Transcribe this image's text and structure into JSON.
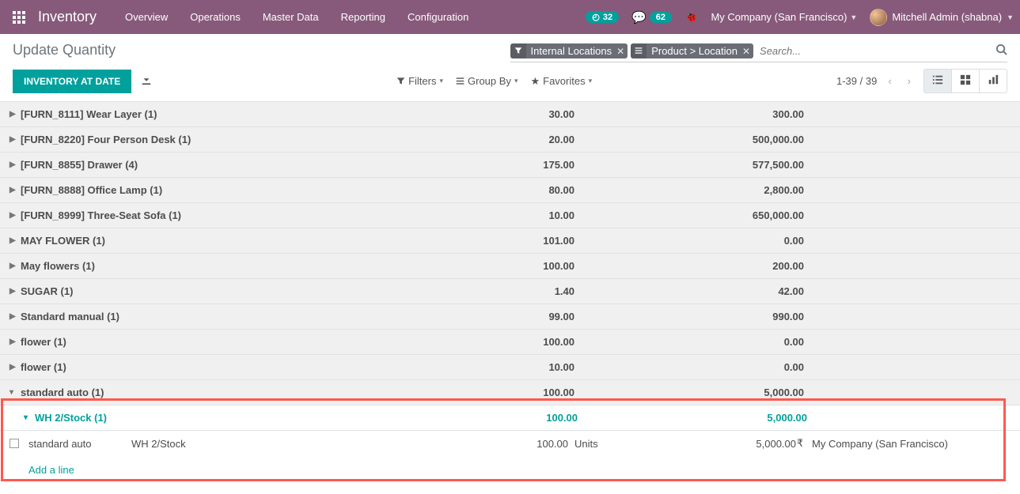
{
  "app_name": "Inventory",
  "nav": [
    "Overview",
    "Operations",
    "Master Data",
    "Reporting",
    "Configuration"
  ],
  "badge_clock": "32",
  "badge_msg": "62",
  "company": "My Company (San Francisco)",
  "user": "Mitchell Admin (shabna)",
  "page_title": "Update Quantity",
  "facet_filter": "Internal Locations",
  "facet_group": "Product > Location",
  "search_placeholder": "Search...",
  "btn_inventory": "Inventory at Date",
  "filters_label": "Filters",
  "groupby_label": "Group By",
  "favorites_label": "Favorites",
  "pager": "1-39 / 39",
  "groups": [
    {
      "name": "[FURN_8111] Wear Layer (1)",
      "qty": "30.00",
      "val": "300.00"
    },
    {
      "name": "[FURN_8220] Four Person Desk (1)",
      "qty": "20.00",
      "val": "500,000.00"
    },
    {
      "name": "[FURN_8855] Drawer (4)",
      "qty": "175.00",
      "val": "577,500.00"
    },
    {
      "name": "[FURN_8888] Office Lamp (1)",
      "qty": "80.00",
      "val": "2,800.00"
    },
    {
      "name": "[FURN_8999] Three-Seat Sofa (1)",
      "qty": "10.00",
      "val": "650,000.00"
    },
    {
      "name": "MAY FLOWER (1)",
      "qty": "101.00",
      "val": "0.00"
    },
    {
      "name": "May flowers (1)",
      "qty": "100.00",
      "val": "200.00"
    },
    {
      "name": "SUGAR (1)",
      "qty": "1.40",
      "val": "42.00"
    },
    {
      "name": "Standard manual (1)",
      "qty": "99.00",
      "val": "990.00"
    },
    {
      "name": "flower (1)",
      "qty": "100.00",
      "val": "0.00"
    },
    {
      "name": "flower (1)",
      "qty": "10.00",
      "val": "0.00"
    }
  ],
  "expanded_group": {
    "name": "standard auto (1)",
    "qty": "100.00",
    "val": "5,000.00"
  },
  "sub_group": {
    "name": "WH 2/Stock (1)",
    "qty": "100.00",
    "val": "5,000.00"
  },
  "data_row": {
    "product": "standard auto",
    "location": "WH 2/Stock",
    "qty": "100.00",
    "uom": "Units",
    "value": "5,000.00",
    "currency": "₹",
    "row_company": "My Company (San Francisco)"
  },
  "add_line": "Add a line"
}
